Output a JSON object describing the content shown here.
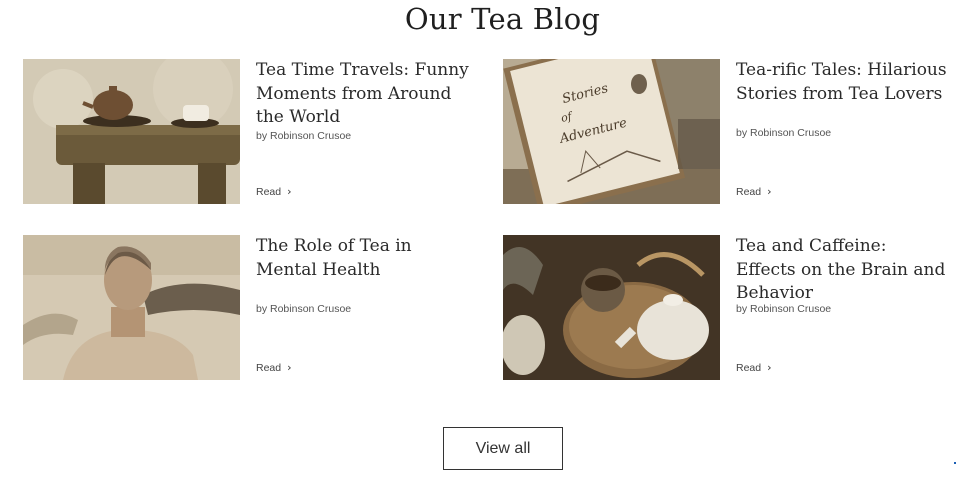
{
  "page": {
    "title": "Our Tea Blog"
  },
  "posts": [
    {
      "title": "Tea Time Travels: Funny Moments from Around the World",
      "author": "by Robinson Crusoe",
      "read_label": "Read"
    },
    {
      "title": "Tea-rific Tales: Hilarious Stories from Tea Lovers",
      "author": "by Robinson Crusoe",
      "read_label": "Read"
    },
    {
      "title": "The Role of Tea in Mental Health",
      "author": "by Robinson Crusoe",
      "read_label": "Read"
    },
    {
      "title": "Tea and Caffeine: Effects on the Brain and Behavior",
      "author": "by Robinson Crusoe",
      "read_label": "Read"
    }
  ],
  "book_cover": {
    "line1": "Stories",
    "line2": "of",
    "line3": "Adventure"
  },
  "view_all_label": "View all",
  "icons": {
    "read_arrow": "chevron-right-icon"
  }
}
